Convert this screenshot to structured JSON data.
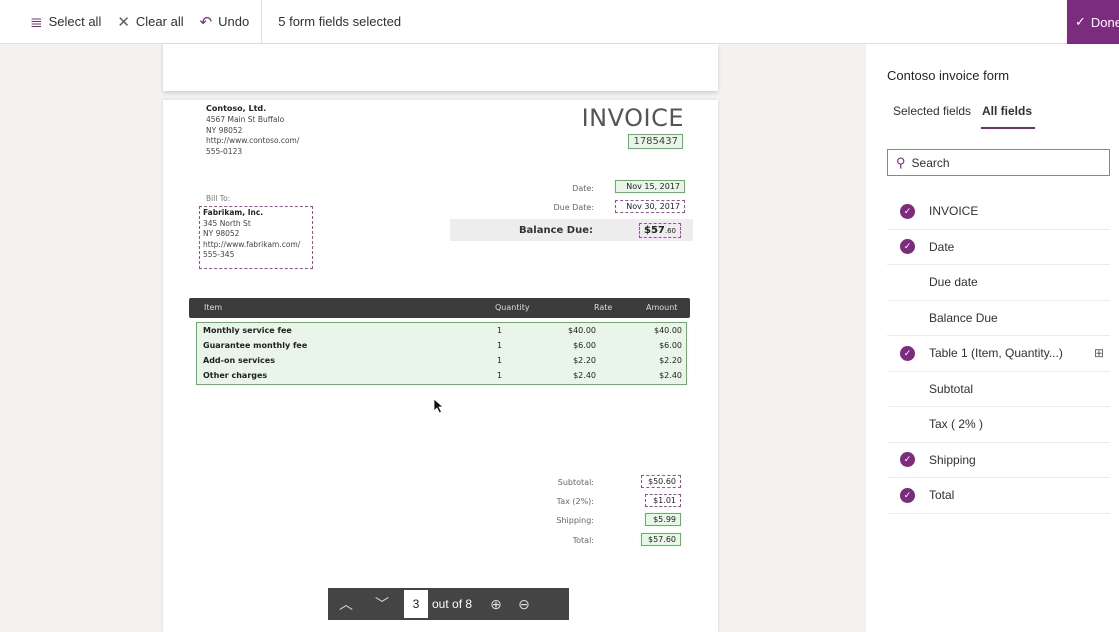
{
  "toolbar": {
    "select_all": "Select all",
    "clear_all": "Clear all",
    "undo": "Undo",
    "status": "5 form fields selected",
    "done": "Done",
    "accent_color": "#7b2c7e"
  },
  "invoice": {
    "company": {
      "name": "Contoso, Ltd.",
      "lines": [
        "4567 Main St Buffalo",
        "NY 98052",
        "http://www.contoso.com/",
        "555-0123"
      ]
    },
    "title": "INVOICE",
    "number": "1785437",
    "bill_to_label": "Bill To:",
    "bill_to": {
      "name": "Fabrikam, Inc.",
      "lines": [
        "345 North St",
        "NY 98052",
        "http://www.fabrikam.com/",
        "555-345"
      ]
    },
    "date_label": "Date:",
    "date": "Nov 15, 2017",
    "due_date_label": "Due Date:",
    "due_date": "Nov 30, 2017",
    "balance_label": "Balance Due:",
    "balance_big": "$57",
    "balance_small": ".60",
    "table": {
      "headers": [
        "Item",
        "Quantity",
        "Rate",
        "Amount"
      ],
      "rows": [
        [
          "Monthly service fee",
          "1",
          "$40.00",
          "$40.00"
        ],
        [
          "Guarantee monthly fee",
          "1",
          "$6.00",
          "$6.00"
        ],
        [
          "Add-on services",
          "1",
          "$2.20",
          "$2.20"
        ],
        [
          "Other charges",
          "1",
          "$2.40",
          "$2.40"
        ]
      ]
    },
    "subtotal_label": "Subtotal:",
    "subtotal": "$50.60",
    "tax_label": "Tax (2%):",
    "tax": "$1.01",
    "shipping_label": "Shipping:",
    "shipping": "$5.99",
    "total_label": "Total:",
    "total": "$57.60"
  },
  "pager": {
    "current_page": "3",
    "out_of": "out of 8"
  },
  "panel": {
    "title": "Contoso invoice form",
    "tab_selected": "Selected fields",
    "tab_all": "All fields",
    "search_placeholder": "Search",
    "fields": [
      {
        "label": "INVOICE",
        "checked": true
      },
      {
        "label": "Date",
        "checked": true
      },
      {
        "label": "Due date",
        "checked": false
      },
      {
        "label": "Balance Due",
        "checked": false
      },
      {
        "label": "Table 1 (Item, Quantity...)",
        "checked": true,
        "icon": "table-icon"
      },
      {
        "label": "Subtotal",
        "checked": false
      },
      {
        "label": "Tax ( 2% )",
        "checked": false
      },
      {
        "label": "Shipping",
        "checked": true
      },
      {
        "label": "Total",
        "checked": true
      }
    ]
  }
}
